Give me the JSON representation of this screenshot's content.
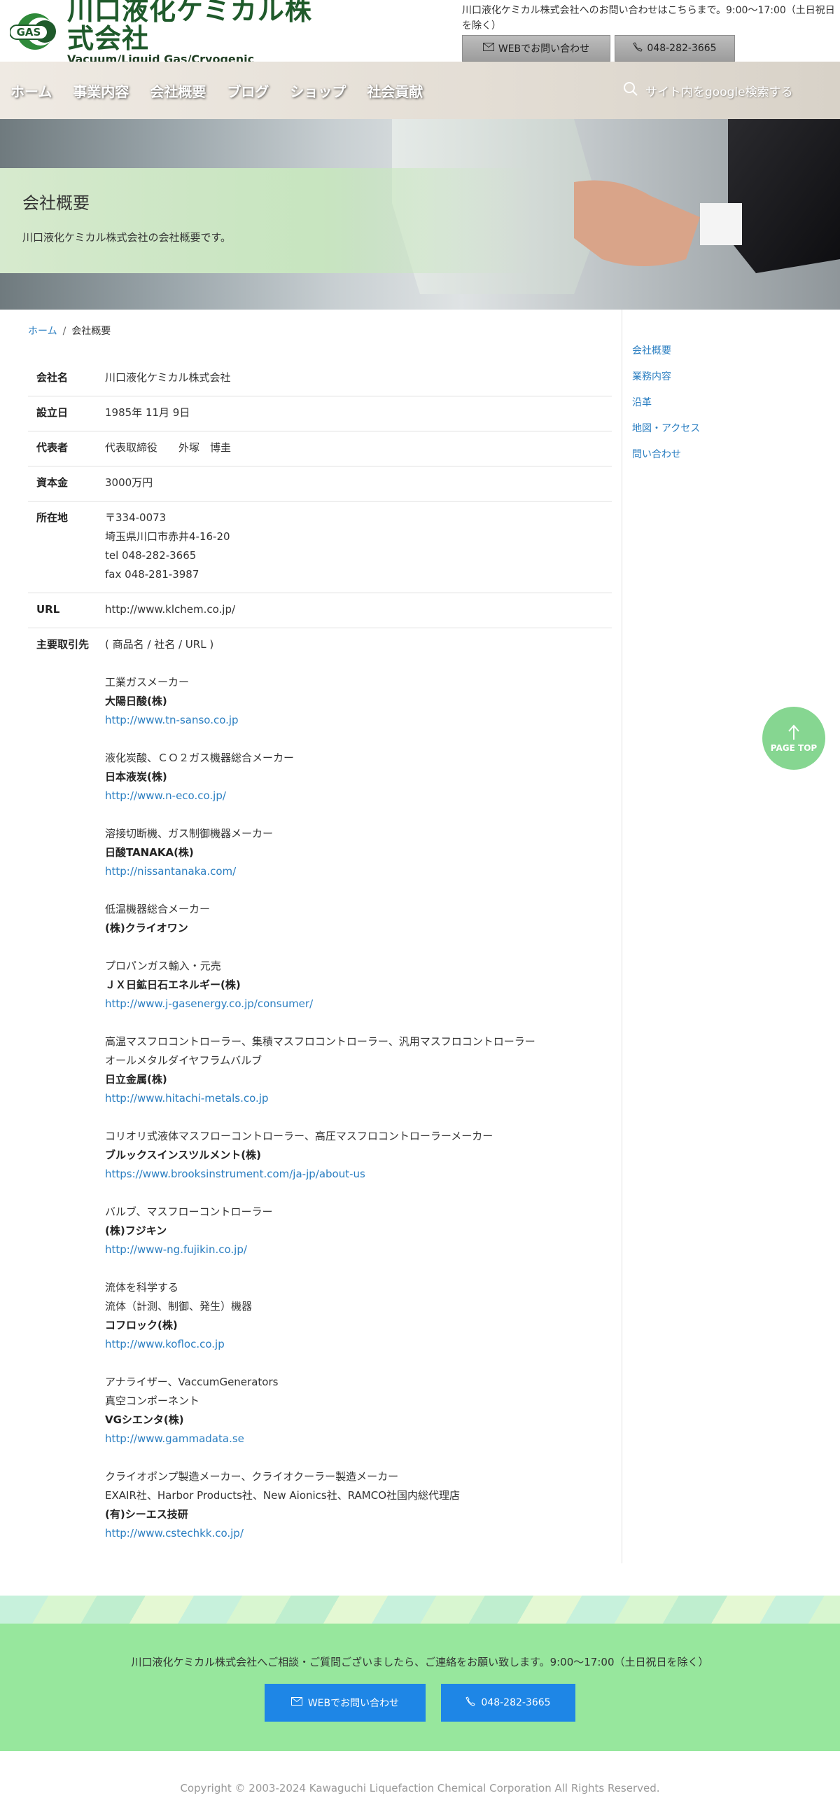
{
  "header": {
    "logo_title": "川口液化ケミカル株式会社",
    "logo_sub": "Vacuum/Liquid Gas/Cryogenic",
    "logo_mark": "GAS",
    "contact_note": "川口液化ケミカル株式会社へのお問い合わせはこちらまで。9:00〜17:00（土日祝日を除く）",
    "web_button": "WEBでお問い合わせ",
    "tel_button": "048-282-3665"
  },
  "nav": {
    "items": [
      "ホーム",
      "事業内容",
      "会社概要",
      "ブログ",
      "ショップ",
      "社会貢献"
    ],
    "search_placeholder": "サイト内をgoogle検索する"
  },
  "hero": {
    "title": "会社概要",
    "description": "川口液化ケミカル株式会社の会社概要です。"
  },
  "breadcrumb": {
    "home": "ホーム",
    "separator": "/",
    "current": "会社概要"
  },
  "company": {
    "rows": [
      {
        "label": "会社名",
        "value": "川口液化ケミカル株式会社"
      },
      {
        "label": "設立日",
        "value": "1985年 11月 9日"
      },
      {
        "label": "代表者",
        "value": "代表取締役　　外塚　博圭"
      },
      {
        "label": "資本金",
        "value": "3000万円"
      },
      {
        "label": "所在地",
        "lines": [
          "〒334-0073",
          "埼玉県川口市赤井4-16-20",
          "tel 048-282-3665",
          "fax 048-281-3987"
        ]
      },
      {
        "label": "URL",
        "value": "http://www.klchem.co.jp/"
      }
    ],
    "partners_label": "主要取引先",
    "partners_header": "( 商品名 / 社名 / URL )",
    "partners": [
      {
        "desc": [
          "工業ガスメーカー"
        ],
        "name": "大陽日酸(株)",
        "url": "http://www.tn-sanso.co.jp"
      },
      {
        "desc": [
          "液化炭酸、ＣＯ２ガス機器総合メーカー"
        ],
        "name": "日本液炭(株)",
        "url": "http://www.n-eco.co.jp/"
      },
      {
        "desc": [
          "溶接切断機、ガス制御機器メーカー"
        ],
        "name": "日酸TANAKA(株)",
        "url": "http://nissantanaka.com/"
      },
      {
        "desc": [
          "低温機器総合メーカー"
        ],
        "name": "(株)クライオワン",
        "url": ""
      },
      {
        "desc": [
          "プロパンガス輸入・元売"
        ],
        "name": "ＪＸ日鉱日石エネルギー(株)",
        "url": "http://www.j-gasenergy.co.jp/consumer/"
      },
      {
        "desc": [
          "高温マスフロコントローラー、集積マスフロコントローラー、汎用マスフロコントローラー",
          "オールメタルダイヤフラムバルブ"
        ],
        "name": "日立金属(株)",
        "url": "http://www.hitachi-metals.co.jp"
      },
      {
        "desc": [
          "コリオリ式液体マスフローコントローラー、高圧マスフロコントローラーメーカー"
        ],
        "name": "ブルックスインスツルメント(株)",
        "url": "https://www.brooksinstrument.com/ja-jp/about-us"
      },
      {
        "desc": [
          "バルブ、マスフローコントローラー"
        ],
        "name": "(株)フジキン",
        "url": "http://www-ng.fujikin.co.jp/"
      },
      {
        "desc": [
          "流体を科学する",
          "流体（計測、制御、発生）機器"
        ],
        "name": "コフロック(株)",
        "url": "http://www.kofloc.co.jp"
      },
      {
        "desc": [
          "アナライザー、VaccumGenerators",
          "真空コンポーネント"
        ],
        "name": "VGシエンタ(株)",
        "url": "http://www.gammadata.se"
      },
      {
        "desc": [
          "クライオポンプ製造メーカー、クライオクーラー製造メーカー",
          "EXAIR社、Harbor Products社、New Aionics社、RAMCO社国内総代理店"
        ],
        "name": "(有)シーエス技研",
        "url": "http://www.cstechkk.co.jp/"
      }
    ]
  },
  "sidebar": {
    "links": [
      "会社概要",
      "業務内容",
      "沿革",
      "地図・アクセス",
      "問い合わせ"
    ]
  },
  "pagetop": {
    "label": "PAGE TOP"
  },
  "cta": {
    "text": "川口液化ケミカル株式会社へご相談・ご質問ございましたら、ご連絡をお願い致します。9:00〜17:00（土日祝日を除く）",
    "web_button": "WEBでお問い合わせ",
    "tel_button": "048-282-3665"
  },
  "footer": {
    "copyright": "Copyright © 2003-2024 Kawaguchi Liquefaction Chemical Corporation All Rights Reserved."
  },
  "colors": {
    "link": "#2a7ec1",
    "cta_bg": "#97e79d",
    "cta_button": "#1e86e6",
    "pagetop": "#86d691",
    "logo_green": "#1f5a2b"
  }
}
